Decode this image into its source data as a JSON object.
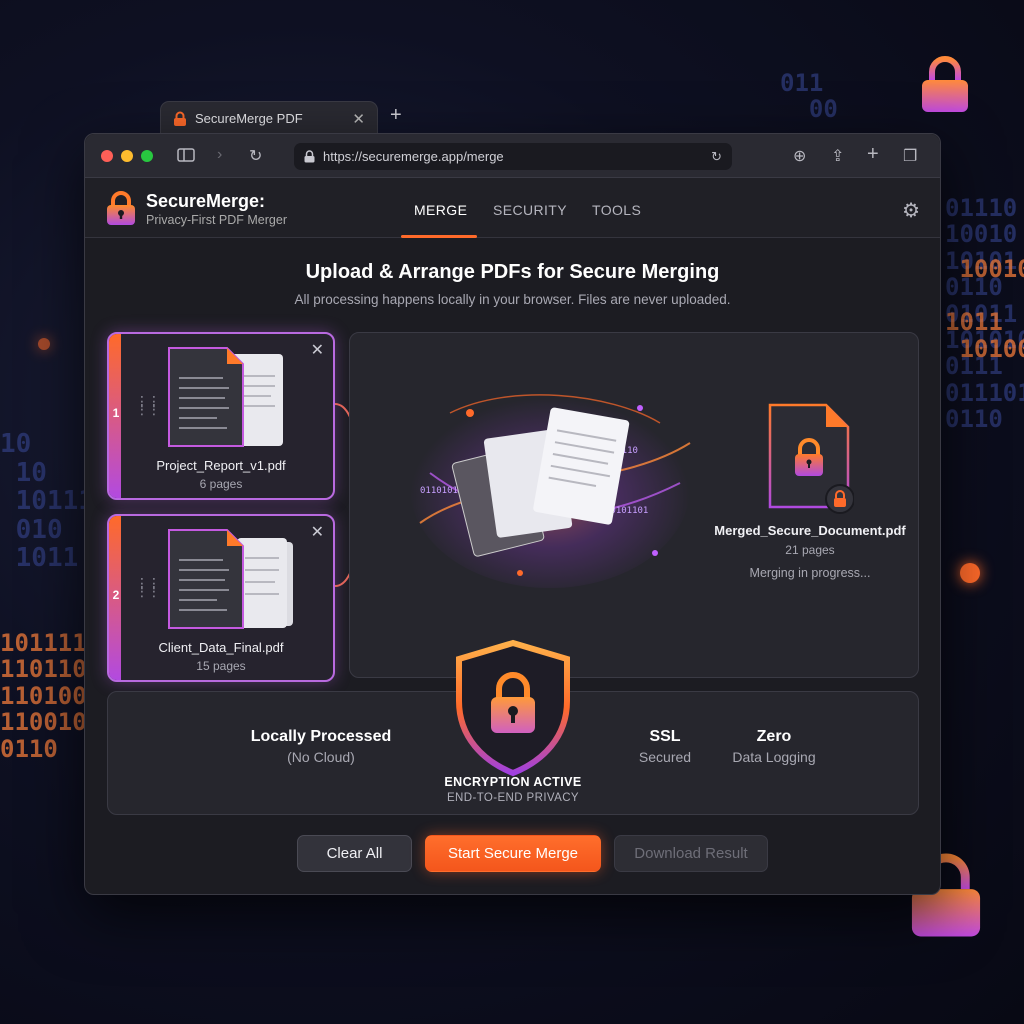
{
  "browser": {
    "tab_title": "SecureMerge PDF",
    "url": "https://securemerge.app/merge"
  },
  "app": {
    "title": "SecureMerge:",
    "subtitle": "Privacy-First PDF Merger",
    "nav": [
      {
        "label": "MERGE",
        "active": true
      },
      {
        "label": "SECURITY",
        "active": false
      },
      {
        "label": "TOOLS",
        "active": false
      }
    ]
  },
  "main": {
    "title": "Upload & Arrange PDFs for Secure Merging",
    "subtitle": "All processing happens locally in your browser. Files are never uploaded."
  },
  "files": [
    {
      "index": "1",
      "name": "Project_Report_v1.pdf",
      "pages": "6 pages"
    },
    {
      "index": "2",
      "name": "Client_Data_Final.pdf",
      "pages": "15 pages"
    }
  ],
  "output": {
    "name": "Merged_Secure_Document.pdf",
    "pages": "21 pages",
    "status": "Merging in progress..."
  },
  "security": {
    "local": {
      "title": "Locally Processed",
      "sub": "(No Cloud)"
    },
    "ssl": {
      "title": "SSL",
      "sub": "Secured"
    },
    "zero": {
      "title": "Zero",
      "sub": "Data Logging"
    },
    "encryption_title": "ENCRYPTION ACTIVE",
    "encryption_sub": "END-TO-END PRIVACY"
  },
  "buttons": {
    "clear": "Clear All",
    "start": "Start Secure Merge",
    "download": "Download Result"
  },
  "colors": {
    "accent": "#ff6a2a",
    "purple": "#b24ae0",
    "window_bg": "#1c1c22"
  }
}
